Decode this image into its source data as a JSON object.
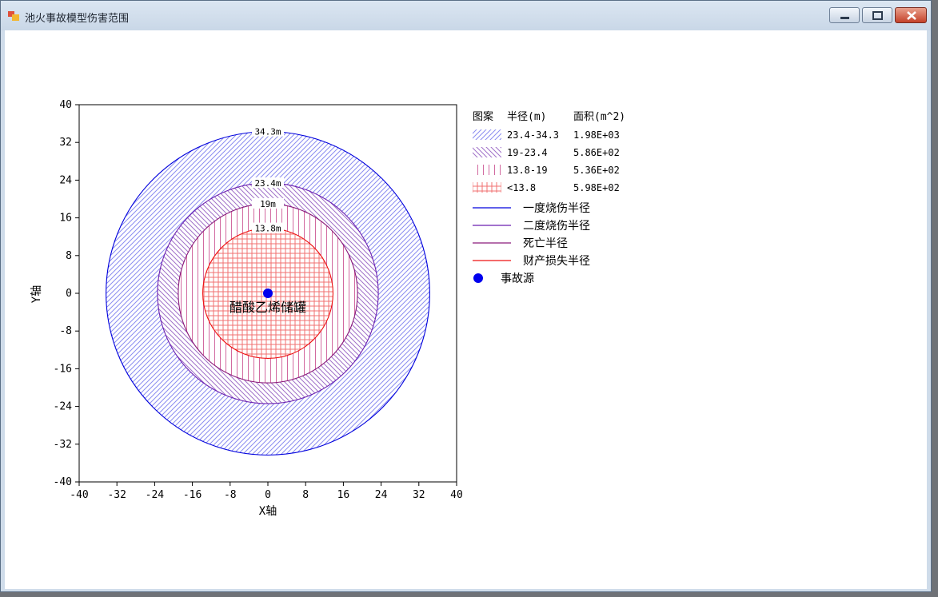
{
  "window": {
    "title": "池火事故模型伤害范围",
    "buttons": {
      "minimize": "minimize",
      "maximize": "maximize",
      "close": "close"
    }
  },
  "chart_data": {
    "type": "scatter",
    "xlabel": "X轴",
    "ylabel": "Y轴",
    "xlim": [
      -40,
      40
    ],
    "ylim": [
      -40,
      40
    ],
    "x_ticks": [
      "-40",
      "-32",
      "-24",
      "-16",
      "-8",
      "0",
      "8",
      "16",
      "24",
      "32",
      "40"
    ],
    "y_ticks": [
      "40",
      "32",
      "24",
      "16",
      "8",
      "0",
      "-8",
      "-16",
      "-24",
      "-32",
      "-40"
    ],
    "center": [
      0,
      0
    ],
    "source_label": "醋酸乙烯储罐",
    "circles": [
      {
        "radius": 34.3,
        "label": "34.3m",
        "color": "#0000dd"
      },
      {
        "radius": 23.4,
        "label": "23.4m",
        "color": "#6a1fb0"
      },
      {
        "radius": 19,
        "label": "19m",
        "color": "#8a1a7a"
      },
      {
        "radius": 13.8,
        "label": "13.8m",
        "color": "#ee1111"
      }
    ],
    "bands": [
      {
        "range": [
          23.4,
          34.3
        ],
        "pattern": "fwd-diag",
        "color": "#8a8cf0"
      },
      {
        "range": [
          19,
          23.4
        ],
        "pattern": "back-diag",
        "color": "#a070c8"
      },
      {
        "range": [
          13.8,
          19
        ],
        "pattern": "vertical",
        "color": "#d26aa0"
      },
      {
        "range": [
          0,
          13.8
        ],
        "pattern": "grid",
        "color": "#f07070"
      }
    ],
    "legend": {
      "headers": {
        "pattern": "图案",
        "radius": "半径(m)",
        "area": "面积(m^2)"
      },
      "rows": [
        {
          "pattern": "fwd-diag",
          "radius": "23.4-34.3",
          "area": "1.98E+03"
        },
        {
          "pattern": "back-diag",
          "radius": "19-23.4",
          "area": "5.86E+02"
        },
        {
          "pattern": "vertical",
          "radius": "13.8-19",
          "area": "5.36E+02"
        },
        {
          "pattern": "grid",
          "radius": "<13.8",
          "area": "5.98E+02"
        }
      ],
      "lines": [
        {
          "label": "一度烧伤半径",
          "color": "#0000dd"
        },
        {
          "label": "二度烧伤半径",
          "color": "#6a1fb0"
        },
        {
          "label": "死亡半径",
          "color": "#8a1a7a"
        },
        {
          "label": "财产损失半径",
          "color": "#ee1111"
        }
      ],
      "source": {
        "label": "事故源",
        "color": "#0000ee"
      }
    }
  }
}
